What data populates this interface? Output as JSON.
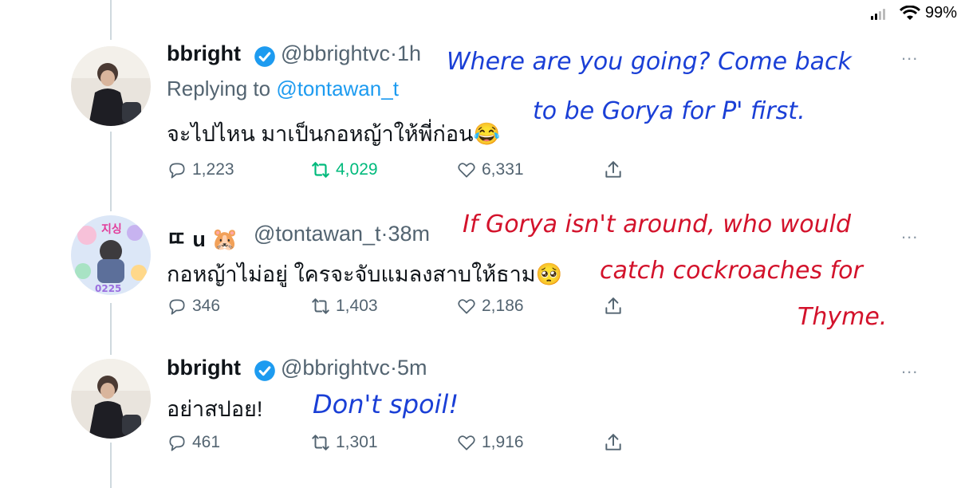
{
  "status_bar": {
    "battery": "99%"
  },
  "tweets": [
    {
      "name": "bbright",
      "handle": "@bbrightvc",
      "time": "1h",
      "replying_prefix": "Replying to ",
      "replying_to": "@tontawan_t",
      "text": "จะไปไหน มาเป็นกอหญ้าให้พี่ก่อน",
      "emoji": "😂",
      "replies": "1,223",
      "retweets": "4,029",
      "likes": "6,331",
      "menu": "..."
    },
    {
      "name": "ㄸ u",
      "handle_emoji": "🐹",
      "handle": "@tontawan_t",
      "time": "38m",
      "text": "กอหญ้าไม่อยู่ ใครจะจับแมลงสาบให้ธาม",
      "emoji": "🥺",
      "replies": "346",
      "retweets": "1,403",
      "likes": "2,186",
      "menu": "..."
    },
    {
      "name": "bbright",
      "handle": "@bbrightvc",
      "time": "5m",
      "text": "อย่าสปอย!",
      "replies": "461",
      "retweets": "1,301",
      "likes": "1,916",
      "menu": "..."
    }
  ],
  "annotations": {
    "a1_line1": "Where are you going?  Come back",
    "a1_line2": "to be Gorya for P' first.",
    "a2_line1": "If Gorya isn't around, who would",
    "a2_line2": "catch cockroaches for",
    "a2_line3": "Thyme.",
    "a3": "Don't spoil!"
  },
  "colors": {
    "verified": "#1d9bf0",
    "retweeted": "#00ba7c",
    "annotation_blue": "#1a3fd6",
    "annotation_red": "#d3122b"
  }
}
